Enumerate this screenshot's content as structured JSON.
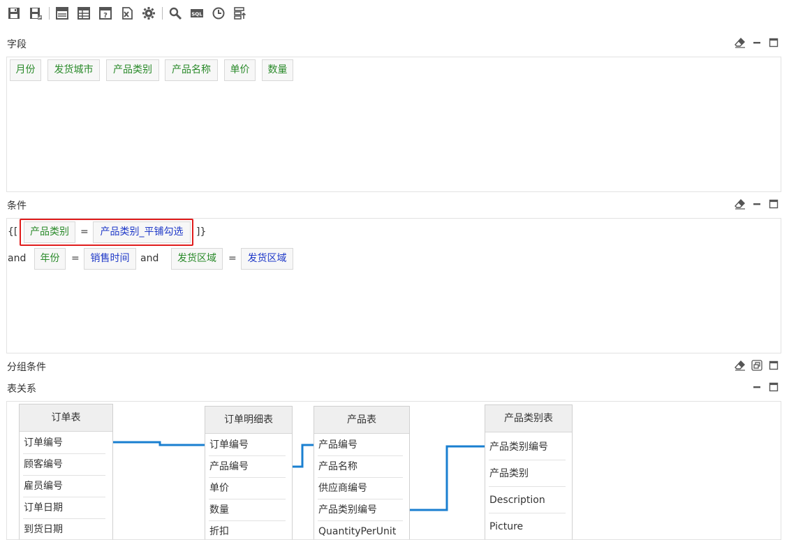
{
  "toolbar": {
    "buttons": [
      "save-icon",
      "save-as-icon",
      "table-view-icon",
      "table-grid-icon",
      "help-table-icon",
      "excel-icon",
      "gear-icon",
      "search-icon",
      "sql-icon",
      "clock-icon",
      "layout-icon"
    ]
  },
  "fields": {
    "title": "字段",
    "items": [
      "月份",
      "发货城市",
      "产品类别",
      "产品名称",
      "单价",
      "数量"
    ]
  },
  "conditions": {
    "title": "条件",
    "open": "{[",
    "close": "]}",
    "line1": {
      "field": "产品类别",
      "op": "=",
      "value": "产品类别_平铺勾选"
    },
    "line2": {
      "lead": "and",
      "f1": "年份",
      "op1": "=",
      "v1": "销售时间",
      "conj": "and",
      "f2": "发货区域",
      "op2": "=",
      "v2": "发货区域"
    }
  },
  "groups": {
    "title": "分组条件"
  },
  "relations": {
    "title": "表关系",
    "tables": [
      {
        "name": "订单表",
        "fields": [
          "订单编号",
          "顾客编号",
          "雇员编号",
          "订单日期",
          "到货日期"
        ]
      },
      {
        "name": "订单明细表",
        "fields": [
          "订单编号",
          "产品编号",
          "单价",
          "数量",
          "折扣"
        ]
      },
      {
        "name": "产品表",
        "fields": [
          "产品编号",
          "产品名称",
          "供应商编号",
          "产品类别编号",
          "QuantityPerUnit"
        ]
      },
      {
        "name": "产品类别表",
        "fields": [
          "产品类别编号",
          "产品类别",
          "Description",
          "Picture"
        ]
      }
    ]
  },
  "colors": {
    "field_green": "#2a8a2a",
    "param_blue": "#1f39c8",
    "highlight_red": "#e01c1c",
    "link_blue": "#1a7fd0"
  }
}
